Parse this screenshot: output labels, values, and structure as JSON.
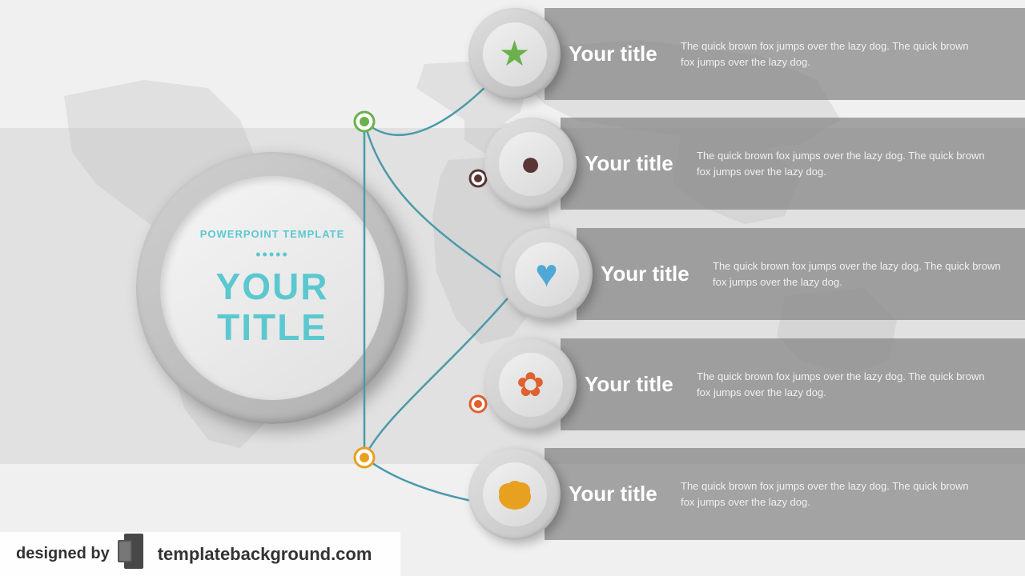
{
  "background": {
    "color": "#f0f0f0"
  },
  "center_circle": {
    "subtitle": "POWERPOINT TEMPLATE",
    "dots": "•••••",
    "title_line1": "YOUR",
    "title_line2": "TITLE"
  },
  "panels": [
    {
      "id": 1,
      "title": "Your title",
      "description": "The quick brown fox jumps over the lazy dog. The quick brown fox jumps over the lazy dog.",
      "icon": "★",
      "icon_color": "#6ab04c",
      "dot_color_outer": "#6ab04c",
      "dot_color_inner": "#ffffff"
    },
    {
      "id": 2,
      "title": "Your title",
      "description": "The quick brown fox jumps over the lazy dog. The quick brown fox jumps over the lazy dog.",
      "icon": "●",
      "icon_color": "#5a3535",
      "dot_color_outer": "#5a3535",
      "dot_color_inner": "#ffffff"
    },
    {
      "id": 3,
      "title": "Your title",
      "description": "The quick brown fox jumps over the lazy dog. The quick brown fox jumps over the lazy dog.",
      "icon": "♥",
      "icon_color": "#4fa8d5",
      "dot_color_outer": "#4fa8d5",
      "dot_color_inner": "#ffffff"
    },
    {
      "id": 4,
      "title": "Your title",
      "description": "The quick brown fox jumps over the lazy dog. The quick brown fox jumps over the lazy dog.",
      "icon": "✿",
      "icon_color": "#e06030",
      "dot_color_outer": "#e06030",
      "dot_color_inner": "#ffffff"
    },
    {
      "id": 5,
      "title": "Your title",
      "description": "The quick brown fox jumps over the lazy dog. The quick brown fox jumps over the lazy dog.",
      "icon": "❧",
      "icon_color": "#e8a020",
      "dot_color_outer": "#e8a020",
      "dot_color_inner": "#ffffff"
    }
  ],
  "footer": {
    "designed_by": "designed by",
    "url": "templatebackground.com"
  }
}
